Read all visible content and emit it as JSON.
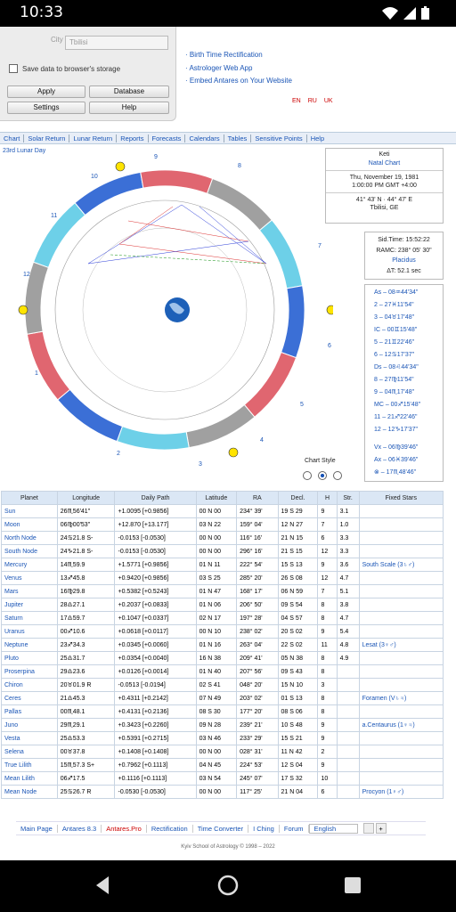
{
  "status": {
    "time": "10:33"
  },
  "settings": {
    "city_label": "City",
    "city_value": "Tbilisi",
    "save_label": "Save data to browser's storage",
    "buttons": [
      "Apply",
      "Database",
      "Settings",
      "Help"
    ]
  },
  "links": [
    "· Birth Time Rectification",
    "· Astrologer Web App",
    "· Embed Antares on Your Website"
  ],
  "languages": [
    "EN",
    "RU",
    "UK"
  ],
  "menu": [
    "Chart",
    "Solar Return",
    "Lunar Return",
    "Reports",
    "Forecasts",
    "Calendars",
    "Tables",
    "Sensitive Points",
    "Help"
  ],
  "lunar_day": "23rd Lunar Day",
  "natal": {
    "name": "Keti",
    "chart_type": "Natal Chart",
    "date": "Thu, November 19, 1981",
    "time": "1:00:00 PM  GMT +4:00",
    "coords": "41° 43' N · 44° 47' E",
    "city": "Tbilisi, GE"
  },
  "sidereal": {
    "sid_time": "Sid.Time: 15:52:22",
    "ramc": "RAMC: 238° 05' 30\"",
    "system": "Placidus",
    "delta_t": "ΔT: 52.1 sec"
  },
  "cusps": [
    "As – 08♒44'34\"",
    "2 – 27♓11'54\"",
    "3 – 04♉17'48\"",
    "IC – 00♊15'48\"",
    "5 – 21♊22'46\"",
    "6 – 12♋17'37\"",
    "Ds – 08♌44'34\"",
    "8 – 27♍11'54\"",
    "9 – 04♏17'48\"",
    "MC – 00♐15'48\"",
    "11 – 21♐22'46\"",
    "12 – 12♑17'37\"",
    "Vx – 06♍39'46\"",
    "Ax – 06♓39'46\"",
    "⊗ – 17♏48'46\""
  ],
  "wheel": {
    "house_numbers": [
      "9",
      "8",
      "7",
      "6",
      "5",
      "4",
      "3",
      "2",
      "1",
      "12",
      "11",
      "10"
    ]
  },
  "chart_style_label": "Chart Style",
  "table": {
    "headers": [
      "Planet",
      "Longitude",
      "Daily Path",
      "Latitude",
      "RA",
      "Decl.",
      "H",
      "Str.",
      "Fixed Stars"
    ],
    "rows": [
      [
        "Sun",
        "26♏56'41\"",
        "+1.0095 [+0.9856]",
        "00 N 00",
        "234° 39'",
        "19 S 29",
        "9",
        "3.1",
        ""
      ],
      [
        "Moon",
        "06♍00'53\"",
        "+12.870 [+13.177]",
        "03 N 22",
        "159° 04'",
        "12 N 27",
        "7",
        "1.0",
        ""
      ],
      [
        "North Node",
        "24♋21.8 S-",
        "-0.0153 [-0.0530]",
        "00 N 00",
        "116° 16'",
        "21 N 15",
        "6",
        "3.3",
        ""
      ],
      [
        "South Node",
        "24♑21.8 S-",
        "-0.0153 [-0.0530]",
        "00 N 00",
        "296° 16'",
        "21 S 15",
        "12",
        "3.3",
        ""
      ],
      [
        "Mercury",
        "14♏59.9",
        "+1.5771 [+0.9856]",
        "01 N 11",
        "222° 54'",
        "15 S 13",
        "9",
        "3.6",
        "South Scale (3♄♂)"
      ],
      [
        "Venus",
        "13♐45.8",
        "+0.9420 [+0.9856]",
        "03 S 25",
        "285° 20'",
        "26 S 08",
        "12",
        "4.7",
        ""
      ],
      [
        "Mars",
        "16♍29.8",
        "+0.5382 [+0.5243]",
        "01 N 47",
        "168° 17'",
        "06 N 59",
        "7",
        "5.1",
        ""
      ],
      [
        "Jupiter",
        "28♎27.1",
        "+0.2037 [+0.0833]",
        "01 N 06",
        "206° 50'",
        "09 S 54",
        "8",
        "3.8",
        ""
      ],
      [
        "Saturn",
        "17♎59.7",
        "+0.1047 [+0.0337]",
        "02 N 17",
        "197° 28'",
        "04 S 57",
        "8",
        "4.7",
        ""
      ],
      [
        "Uranus",
        "00♐10.6",
        "+0.0618 [+0.0117]",
        "00 N 10",
        "238° 02'",
        "20 S 02",
        "9",
        "5.4",
        ""
      ],
      [
        "Neptune",
        "23♐34.3",
        "+0.0345 [+0.0060]",
        "01 N 16",
        "263° 04'",
        "22 S 02",
        "11",
        "4.8",
        "Lesat (3♀♂)"
      ],
      [
        "Pluto",
        "25♎31.7",
        "+0.0354 [+0.0040]",
        "16 N 38",
        "209° 41'",
        "05 N 38",
        "8",
        "4.9",
        ""
      ],
      [
        "Proserpina",
        "29♎23.6",
        "+0.0126 [+0.0014]",
        "01 N 40",
        "207° 56'",
        "09 S 43",
        "8",
        ""
      ],
      [
        "Chiron",
        "20♉01.9 R",
        "-0.0513 [-0.0194]",
        "02 S 41",
        "048° 20'",
        "15 N 10",
        "3",
        ""
      ],
      [
        "Ceres",
        "21♎45.3",
        "+0.4311 [+0.2142]",
        "07 N 49",
        "203° 02'",
        "01 S 13",
        "8",
        "",
        "Foramen (V♄♃)"
      ],
      [
        "Pallas",
        "00♏48.1",
        "+0.4131 [+0.2136]",
        "08 S 30",
        "177° 20'",
        "08 S 06",
        "8",
        "",
        ""
      ],
      [
        "Juno",
        "29♏29.1",
        "+0.3423 [+0.2260]",
        "09 N 28",
        "239° 21'",
        "10 S 48",
        "9",
        "",
        "a.Centaurus (1♀♃)"
      ],
      [
        "Vesta",
        "25♎53.3",
        "+0.5391 [+0.2715]",
        "03 N 46",
        "233° 29'",
        "15 S 21",
        "9",
        "",
        ""
      ],
      [
        "Selena",
        "00♉37.8",
        "+0.1408 [+0.1408]",
        "00 N 00",
        "028° 31'",
        "11 N 42",
        "2",
        "",
        ""
      ],
      [
        "True Lilith",
        "15♏57.3 S+",
        "+0.7962 [+0.1113]",
        "04 N 45",
        "224° 53'",
        "12 S 04",
        "9",
        "",
        ""
      ],
      [
        "Mean Lilith",
        "06♐17.5",
        "+0.1116 [+0.1113]",
        "03 N 54",
        "245° 07'",
        "17 S 32",
        "10",
        "",
        ""
      ],
      [
        "Mean Node",
        "25♋26.7 R",
        "-0.0530 [-0.0530]",
        "00 N 00",
        "117° 25'",
        "21 N 04",
        "6",
        "",
        "Procyon (1♀♂)"
      ]
    ]
  },
  "footer": [
    "Main Page",
    "Antares 8.3",
    "Antares.Pro",
    "Rectification",
    "Time Converter",
    "I Ching",
    "Forum",
    "English"
  ],
  "copyright": "Kyiv School of Astrology © 1998 – 2022",
  "colors": {
    "fire": "#e06670",
    "earth": "#a0a0a0",
    "air": "#6dd0e8",
    "water": "#3b6fd6",
    "link": "#1a55b6"
  }
}
